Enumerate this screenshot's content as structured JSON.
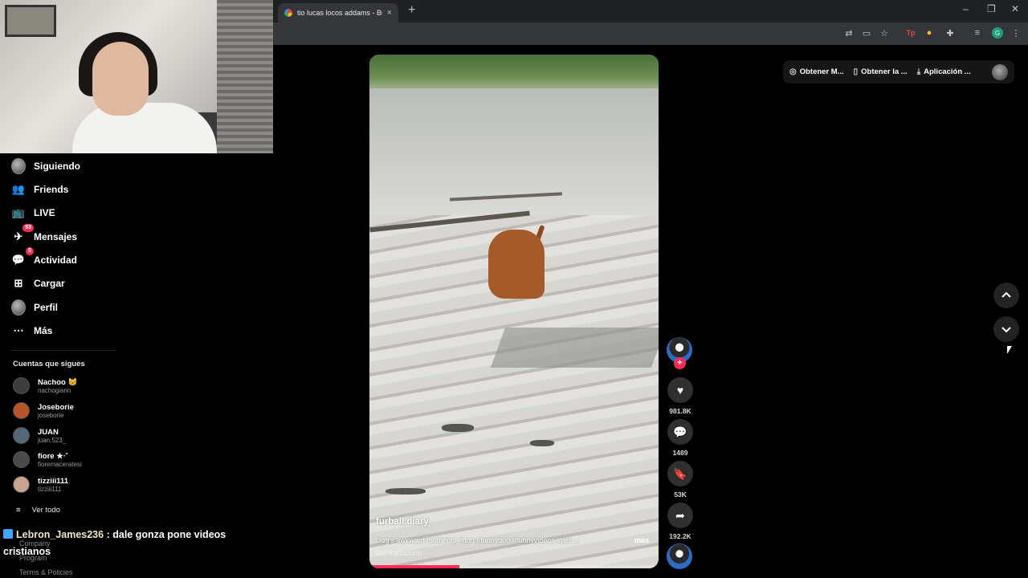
{
  "browser": {
    "tab_title": "tio lucas locos addams - Buscar",
    "new_tab_glyph": "+",
    "tab_close_glyph": "×",
    "profile_initial": "G",
    "window_controls": [
      "–",
      "❐",
      "✕"
    ],
    "toolbar_icons": [
      "translate-icon",
      "cast-icon",
      "bookmark-star-icon",
      "tp-extension-icon",
      "extension-badge-icon",
      "puzzle-extensions-icon",
      "media-queue-icon",
      "profile-icon",
      "kebab-menu-icon"
    ],
    "tp_label": "Tp"
  },
  "sidebar": {
    "nav": [
      {
        "label": "Siguiendo",
        "icon": "following-avatar-icon"
      },
      {
        "label": "Friends",
        "icon": "friends-icon"
      },
      {
        "label": "LIVE",
        "icon": "live-tv-icon"
      },
      {
        "label": "Mensajes",
        "icon": "messages-icon",
        "badge": "53"
      },
      {
        "label": "Actividad",
        "icon": "activity-icon",
        "badge": "5"
      },
      {
        "label": "Cargar",
        "icon": "upload-plus-icon"
      },
      {
        "label": "Perfil",
        "icon": "profile-avatar-icon"
      },
      {
        "label": "Más",
        "icon": "more-dots-icon"
      }
    ],
    "following_title": "Cuentas que sigues",
    "accounts": [
      {
        "name": "Nachoo 😸",
        "handle": "nachogiann",
        "color": "#3c3c3c"
      },
      {
        "name": "Joseborie",
        "handle": "joseborie",
        "color": "#b8562a"
      },
      {
        "name": "JUAN",
        "handle": "juan.523_",
        "color": "#556677"
      },
      {
        "name": "fiore ★·˚",
        "handle": "fioremaceratesi",
        "color": "#4a4a4a"
      },
      {
        "name": "tizziii111",
        "handle": "tizziii111",
        "color": "#c9a490"
      }
    ],
    "see_all": "Ver todo",
    "footer": [
      "Company",
      "Program",
      "Terms & Policies"
    ]
  },
  "chat": {
    "user": "Lebron_James236",
    "separator": ":",
    "message": "dale gonza pone videos cristianos"
  },
  "video": {
    "username": "furball.diary",
    "watermark": "furball.diary",
    "caption": "Dog's awkward moments #dog #funnydog #funnyvideos #pet ...",
    "more": "más",
    "translate": "Ver traducción",
    "progress": 0.31
  },
  "actions": {
    "likes": "981.8K",
    "comments": "1489",
    "saves": "53K",
    "shares": "192.2K"
  },
  "topbar": {
    "btn1": "Obtener M...",
    "btn2": "Obtener la ...",
    "btn3": "Aplicación ..."
  },
  "colors": {
    "accent": "#fe2c55",
    "background": "#000000"
  }
}
